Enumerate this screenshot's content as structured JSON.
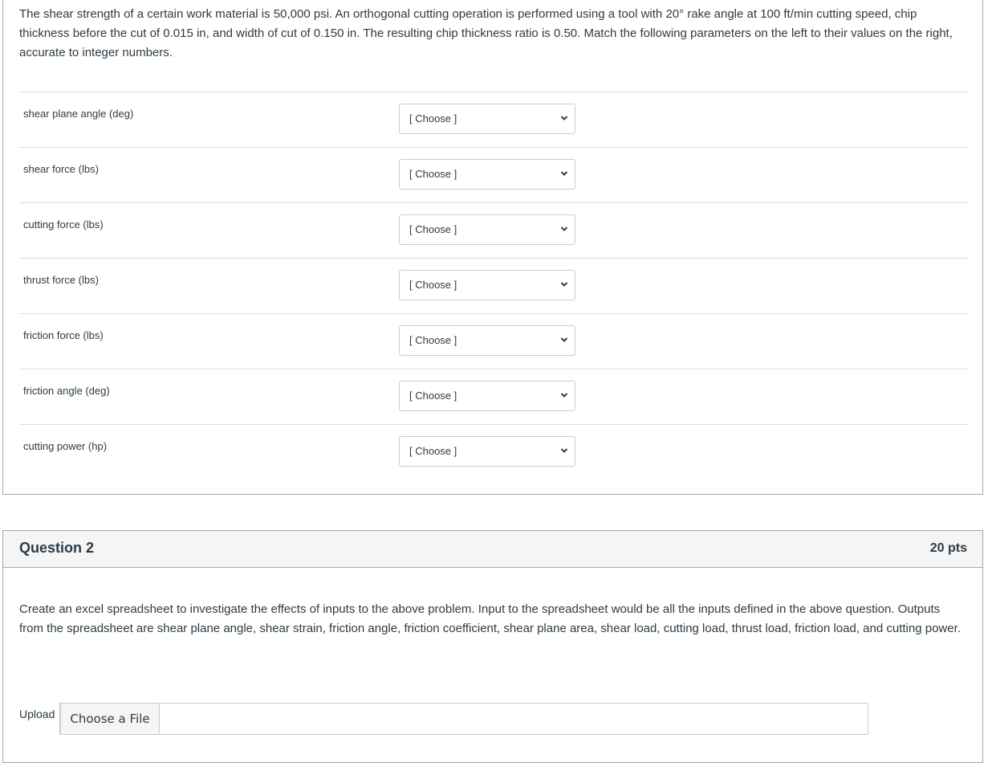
{
  "question1": {
    "prompt": "The shear strength of a certain work material is 50,000 psi.  An orthogonal cutting operation is performed using a tool with 20° rake angle at 100 ft/min cutting speed, chip thickness before the cut of 0.015 in, and width of cut of  0.150 in.  The resulting chip thickness ratio is 0.50.  Match the following parameters on the left to their values on the right, accurate to integer numbers.",
    "matches": [
      {
        "label": "shear plane angle (deg)",
        "selected": "[ Choose ]"
      },
      {
        "label": "shear force (lbs)",
        "selected": "[ Choose ]"
      },
      {
        "label": "cutting force (lbs)",
        "selected": "[ Choose ]"
      },
      {
        "label": "thrust force (lbs)",
        "selected": "[ Choose ]"
      },
      {
        "label": "friction force (lbs)",
        "selected": "[ Choose ]"
      },
      {
        "label": "friction angle (deg)",
        "selected": "[ Choose ]"
      },
      {
        "label": "cutting power (hp)",
        "selected": "[ Choose ]"
      }
    ]
  },
  "question2": {
    "title": "Question 2",
    "points": "20 pts",
    "prompt": "Create an excel spreadsheet to investigate the effects of inputs to the above problem.  Input to the spreadsheet would be all the inputs defined in the above question.  Outputs from the spreadsheet are shear plane angle, shear strain, friction angle, friction coefficient, shear plane area, shear load, cutting load, thrust load, friction load, and cutting power.",
    "upload_label": "Upload",
    "choose_file_label": "Choose a File",
    "file_name": ""
  }
}
